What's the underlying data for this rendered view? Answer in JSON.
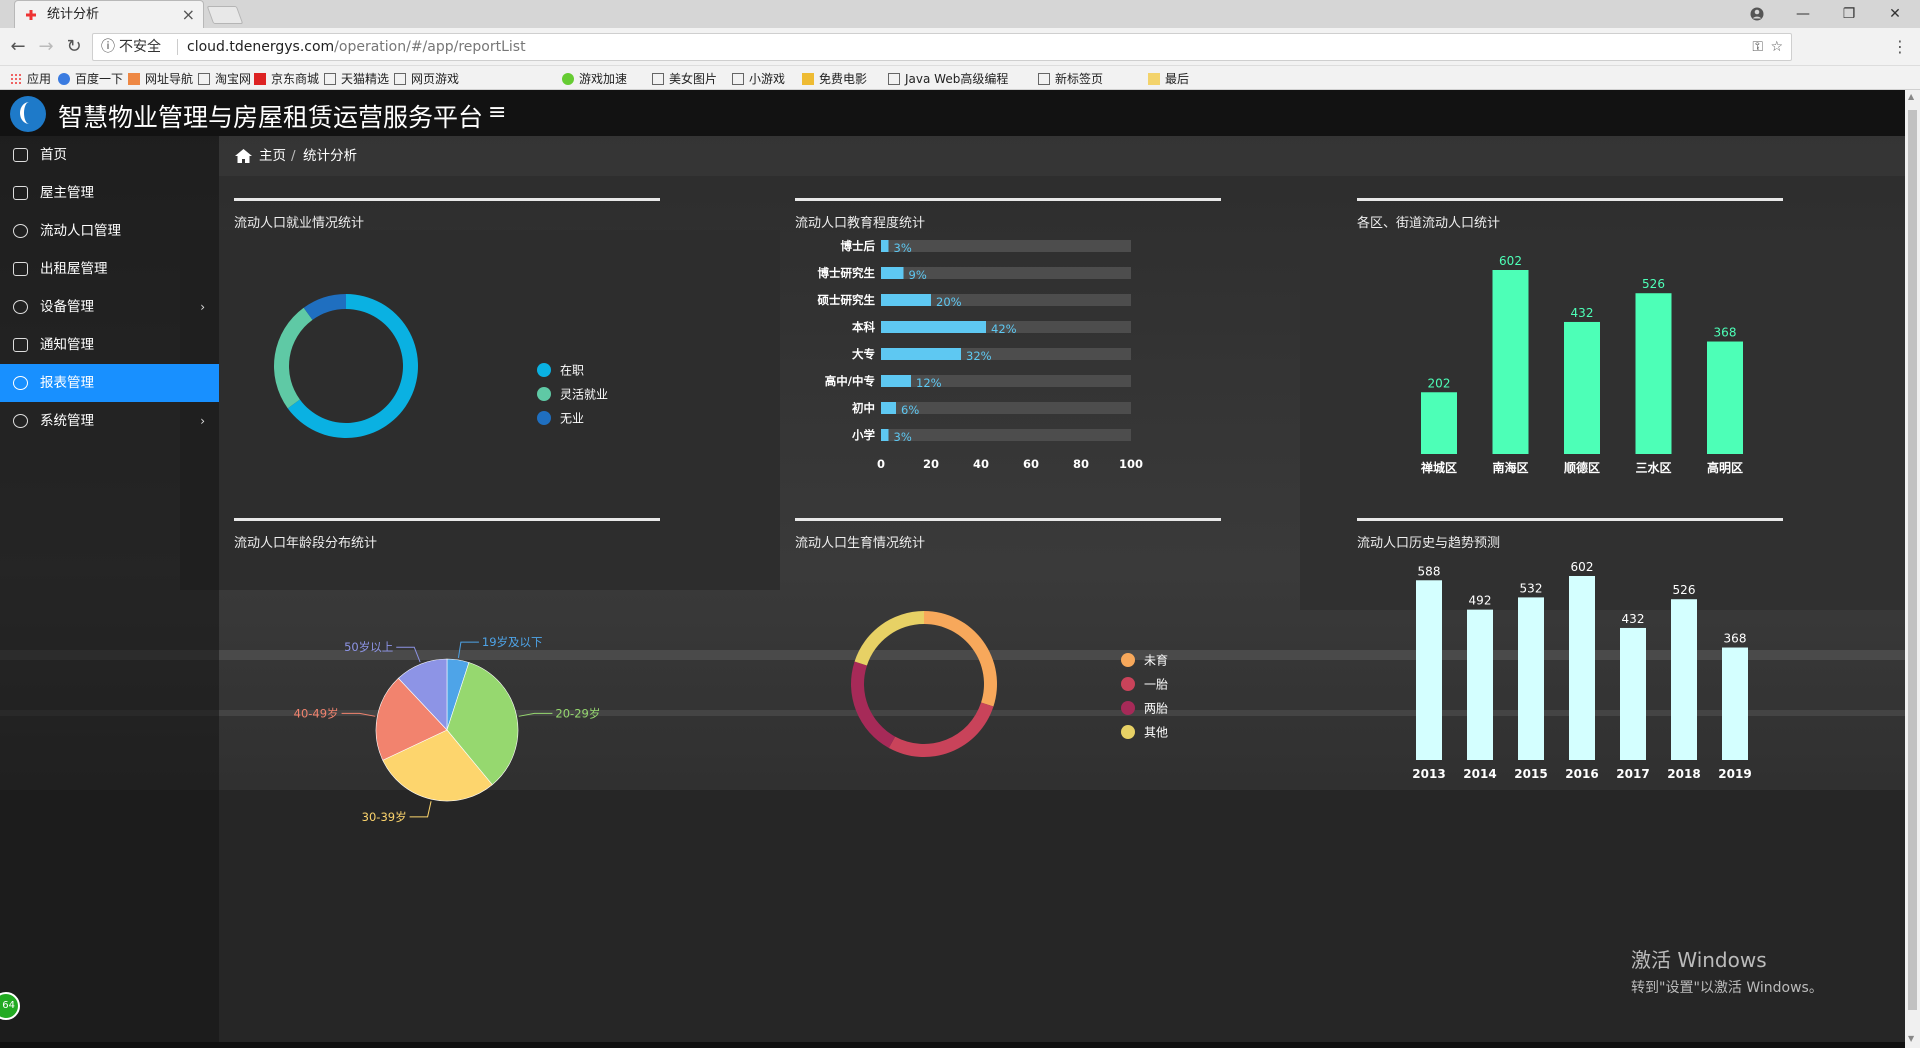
{
  "browser": {
    "tab_title": "统计分析",
    "tab_close": "×",
    "win_minimize": "—",
    "win_restore": "❐",
    "win_close": "✕",
    "insecure_label": "不安全",
    "url_host": "cloud.tdenergys.com",
    "url_path": "/operation/#/app/reportList",
    "bookmarks": [
      "应用",
      "百度一下",
      "网址导航",
      "淘宝网",
      "京东商城",
      "天猫精选",
      "网页游戏",
      "游戏加速",
      "美女图片",
      "小游戏",
      "免费电影",
      "Java Web高级编程",
      "新标签页",
      "最后"
    ]
  },
  "app": {
    "title": "智慧物业管理与房屋租赁运营服务平台",
    "sidebar": [
      {
        "label": "首页"
      },
      {
        "label": "屋主管理"
      },
      {
        "label": "流动人口管理"
      },
      {
        "label": "出租屋管理"
      },
      {
        "label": "设备管理",
        "has_children": true
      },
      {
        "label": "通知管理"
      },
      {
        "label": "报表管理",
        "active": true
      },
      {
        "label": "系统管理",
        "has_children": true
      }
    ],
    "breadcrumb": {
      "home": "主页",
      "sep": "/",
      "current": "统计分析"
    }
  },
  "panels": {
    "employment": "流动人口就业情况统计",
    "education": "流动人口教育程度统计",
    "district": "各区、街道流动人口统计",
    "age": "流动人口年龄段分布统计",
    "fertility": "流动人口生育情况统计",
    "history": "流动人口历史与趋势预测"
  },
  "chart_data": [
    {
      "id": "employment",
      "type": "pie",
      "donut": true,
      "categories": [
        "在职",
        "灵活就业",
        "无业"
      ],
      "values": [
        65,
        25,
        10
      ],
      "colors": [
        "#0ab1e2",
        "#5fc9a5",
        "#1f6fc0"
      ],
      "legend": "right"
    },
    {
      "id": "education",
      "type": "bar",
      "orientation": "horizontal",
      "categories": [
        "博士后",
        "博士研究生",
        "硕士研究生",
        "本科",
        "大专",
        "高中/中专",
        "初中",
        "小学"
      ],
      "values": [
        3,
        9,
        20,
        42,
        32,
        12,
        6,
        3
      ],
      "value_suffix": "%",
      "xlim": [
        0,
        100
      ],
      "xticks": [
        "0",
        "20",
        "40",
        "60",
        "80",
        "100"
      ],
      "colors": {
        "bar": "#5ec8f2",
        "track": "#4d4d4d",
        "label": "#5ec8f2"
      }
    },
    {
      "id": "district",
      "type": "bar",
      "categories": [
        "禅城区",
        "南海区",
        "顺德区",
        "三水区",
        "高明区"
      ],
      "values": [
        202,
        602,
        432,
        526,
        368
      ],
      "colors": {
        "bar": "#4dffb7",
        "label": "#4dffb7"
      }
    },
    {
      "id": "age",
      "type": "pie",
      "categories": [
        "19岁及以下",
        "20-29岁",
        "30-39岁",
        "40-49岁",
        "50岁以上"
      ],
      "values": [
        5,
        34,
        29,
        20,
        12
      ],
      "colors": [
        "#4ea4e8",
        "#96d86f",
        "#fdd56d",
        "#f2836e",
        "#8d94e6"
      ]
    },
    {
      "id": "fertility",
      "type": "pie",
      "donut": true,
      "categories": [
        "未育",
        "一胎",
        "两胎",
        "其他"
      ],
      "values": [
        30,
        28,
        22,
        20
      ],
      "colors": [
        "#f7a85b",
        "#c9435a",
        "#a62a58",
        "#e7d165"
      ],
      "legend": "right"
    },
    {
      "id": "history",
      "type": "bar",
      "categories": [
        "2013",
        "2014",
        "2015",
        "2016",
        "2017",
        "2018",
        "2019"
      ],
      "values": [
        588,
        492,
        532,
        602,
        432,
        526,
        368
      ],
      "colors": {
        "bar": "#d4ffff",
        "label": "#ffffff"
      }
    }
  ],
  "watermark": {
    "line1": "激活 Windows",
    "line2": "转到\"设置\"以激活 Windows。"
  },
  "badge": "64"
}
